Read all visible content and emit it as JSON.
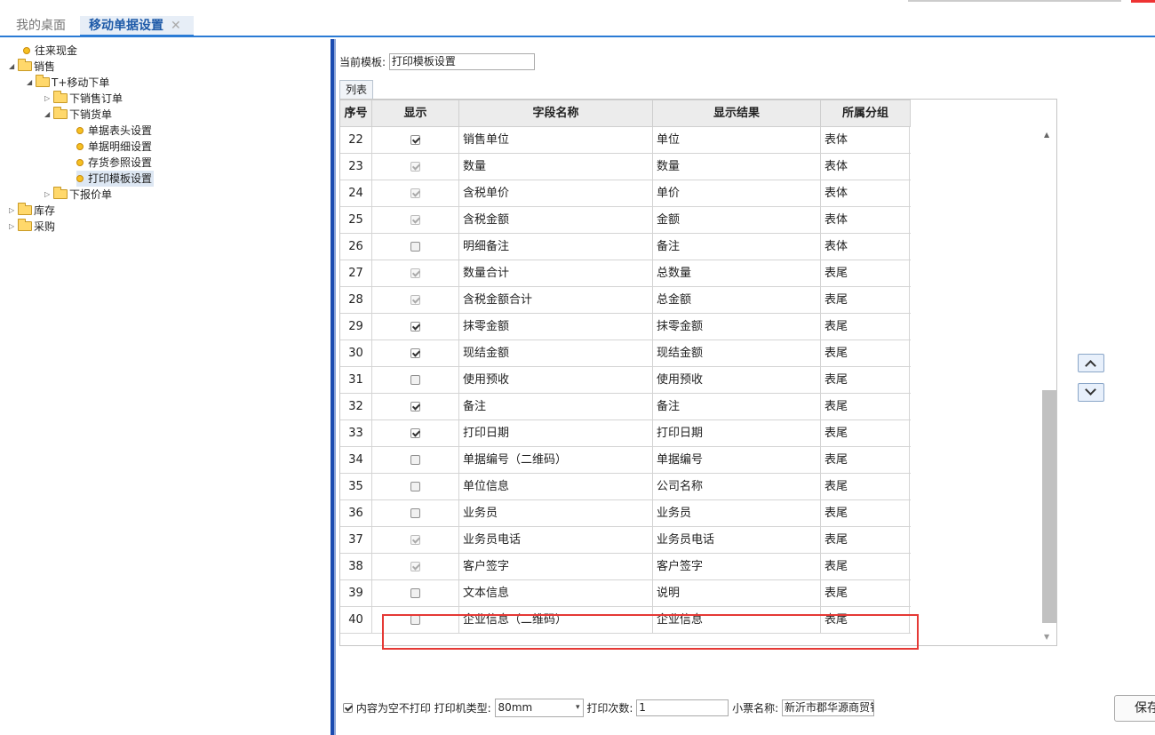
{
  "tabs": {
    "desktop": "我的桌面",
    "active": "移动单据设置",
    "close": "✕"
  },
  "tree": [
    {
      "label": "往来现金"
    },
    {
      "label": "销售"
    },
    {
      "label": "T+移动下单"
    },
    {
      "label": "下销售订单"
    },
    {
      "label": "下销货单"
    },
    {
      "label": "单据表头设置"
    },
    {
      "label": "单据明细设置"
    },
    {
      "label": "存货参照设置"
    },
    {
      "label": "打印模板设置"
    },
    {
      "label": "下报价单"
    },
    {
      "label": "库存"
    },
    {
      "label": "采购"
    }
  ],
  "main": {
    "template_label": "当前模板:",
    "template_value": "打印模板设置",
    "list_tab": "列表"
  },
  "grid": {
    "headers": {
      "no": "序号",
      "show": "显示",
      "field": "字段名称",
      "result": "显示结果",
      "group": "所属分组"
    },
    "rows": [
      {
        "no": "22",
        "checked": true,
        "enabled": true,
        "field": "销售单位",
        "result": "单位",
        "group": "表体"
      },
      {
        "no": "23",
        "checked": true,
        "enabled": false,
        "field": "数量",
        "result": "数量",
        "group": "表体"
      },
      {
        "no": "24",
        "checked": true,
        "enabled": false,
        "field": "含税单价",
        "result": "单价",
        "group": "表体"
      },
      {
        "no": "25",
        "checked": true,
        "enabled": false,
        "field": "含税金额",
        "result": "金额",
        "group": "表体"
      },
      {
        "no": "26",
        "checked": false,
        "enabled": true,
        "field": "明细备注",
        "result": "备注",
        "group": "表体"
      },
      {
        "no": "27",
        "checked": true,
        "enabled": false,
        "field": "数量合计",
        "result": "总数量",
        "group": "表尾"
      },
      {
        "no": "28",
        "checked": true,
        "enabled": false,
        "field": "含税金额合计",
        "result": "总金额",
        "group": "表尾"
      },
      {
        "no": "29",
        "checked": true,
        "enabled": true,
        "field": "抹零金额",
        "result": "抹零金额",
        "group": "表尾"
      },
      {
        "no": "30",
        "checked": true,
        "enabled": true,
        "field": "现结金额",
        "result": "现结金额",
        "group": "表尾"
      },
      {
        "no": "31",
        "checked": false,
        "enabled": true,
        "field": "使用预收",
        "result": "使用预收",
        "group": "表尾"
      },
      {
        "no": "32",
        "checked": true,
        "enabled": true,
        "field": "备注",
        "result": "备注",
        "group": "表尾"
      },
      {
        "no": "33",
        "checked": true,
        "enabled": true,
        "field": "打印日期",
        "result": "打印日期",
        "group": "表尾"
      },
      {
        "no": "34",
        "checked": false,
        "enabled": true,
        "field": "单据编号（二维码）",
        "result": "单据编号",
        "group": "表尾"
      },
      {
        "no": "35",
        "checked": false,
        "enabled": true,
        "field": "单位信息",
        "result": "公司名称",
        "group": "表尾"
      },
      {
        "no": "36",
        "checked": false,
        "enabled": true,
        "field": "业务员",
        "result": "业务员",
        "group": "表尾"
      },
      {
        "no": "37",
        "checked": true,
        "enabled": false,
        "field": "业务员电话",
        "result": "业务员电话",
        "group": "表尾"
      },
      {
        "no": "38",
        "checked": true,
        "enabled": false,
        "field": "客户签字",
        "result": "客户签字",
        "group": "表尾"
      },
      {
        "no": "39",
        "checked": false,
        "enabled": true,
        "field": "文本信息",
        "result": "说明",
        "group": "表尾"
      },
      {
        "no": "40",
        "checked": false,
        "enabled": true,
        "field": "企业信息（二维码）",
        "result": "企业信息",
        "group": "表尾"
      }
    ]
  },
  "footer": {
    "empty_no_print": "内容为空不打印",
    "printer_type_label": "打印机类型:",
    "printer_type_value": "80mm",
    "print_count_label": "打印次数:",
    "print_count_value": "1",
    "receipt_name_label": "小票名称:",
    "receipt_name_value": "新沂市郡华源商贸钅"
  },
  "buttons": {
    "save": "保存"
  },
  "colors": {
    "accent": "#2a7bd5",
    "highlight": "#e53935",
    "tree_selected": "#dde7f3"
  },
  "icons": [
    "folder-icon",
    "leaf-dot-icon",
    "checkbox-icon",
    "chevron-up-icon",
    "chevron-down-icon",
    "close-icon"
  ]
}
